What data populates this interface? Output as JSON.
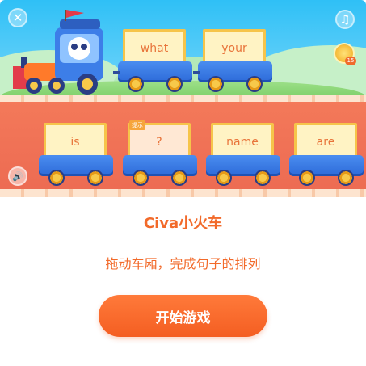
{
  "game": {
    "title": "Civa小火车",
    "subtitle": "拖动车厢，完成句子的排列",
    "start_label": "开始游戏"
  },
  "top_bar": {
    "close_icon": "close-icon",
    "music_icon": "music-icon",
    "coin_count": "15"
  },
  "sound_icon": "speaker-icon",
  "assembled_carts": [
    {
      "word": "what"
    },
    {
      "word": "your"
    }
  ],
  "word_carts": [
    {
      "word": "is",
      "tag": ""
    },
    {
      "word": "?",
      "tag": "提示"
    },
    {
      "word": "name",
      "tag": ""
    },
    {
      "word": "are",
      "tag": ""
    }
  ],
  "colors": {
    "accent": "#f26a2a",
    "sky": "#2fc0f6",
    "ground": "#ef7055",
    "cart_blue": "#2d6ad8",
    "card_border": "#f6c44a"
  }
}
